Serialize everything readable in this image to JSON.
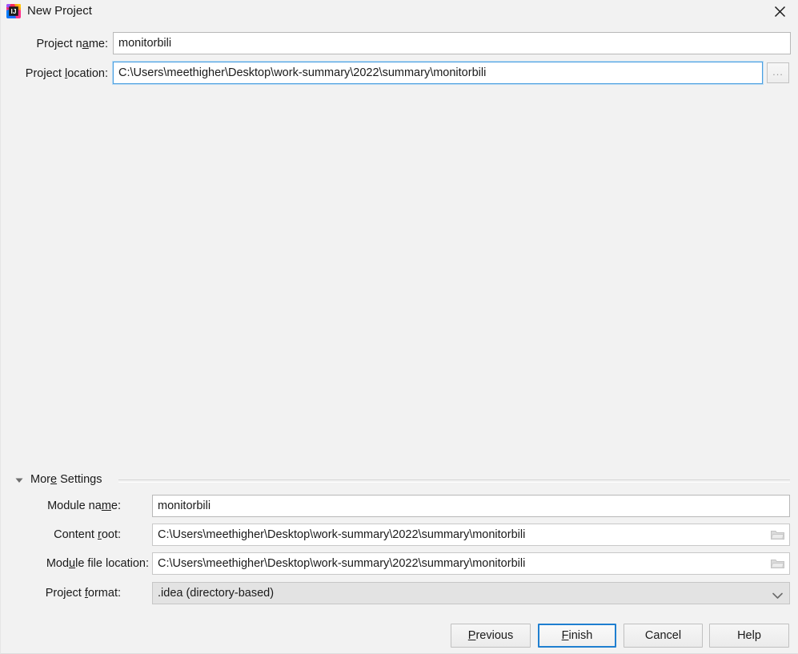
{
  "window": {
    "title": "New Project",
    "app_icon": "intellij-idea-icon",
    "close_icon": "close-icon",
    "background_color": "#f2f2f2"
  },
  "form": {
    "project_name": {
      "label_pre": "Project n",
      "label_mnemonic": "a",
      "label_post": "me:",
      "value": "monitorbili",
      "placeholder": ""
    },
    "project_location": {
      "label_pre": "Project ",
      "label_mnemonic": "l",
      "label_post": "ocation:",
      "value": "C:\\Users\\meethigher\\Desktop\\work-summary\\2022\\summary\\monitorbili",
      "placeholder": "",
      "browse_label": "..."
    }
  },
  "more_settings": {
    "label_pre": "Mor",
    "label_mnemonic": "e",
    "label_post": " Settings",
    "expanded": true,
    "triangle_icon": "chevron-down-icon",
    "fields": {
      "module_name": {
        "label_pre": "Module na",
        "label_mnemonic": "m",
        "label_post": "e:",
        "value": "monitorbili"
      },
      "content_root": {
        "label_pre": "Content ",
        "label_mnemonic": "r",
        "label_post": "oot:",
        "value": "C:\\Users\\meethigher\\Desktop\\work-summary\\2022\\summary\\monitorbili",
        "browse_icon": "folder-icon"
      },
      "module_file_location": {
        "label_pre": "Mod",
        "label_mnemonic": "u",
        "label_post": "le file location:",
        "value": "C:\\Users\\meethigher\\Desktop\\work-summary\\2022\\summary\\monitorbili",
        "browse_icon": "folder-icon"
      },
      "project_format": {
        "label_pre": "Project ",
        "label_mnemonic": "f",
        "label_post": "ormat:",
        "value": ".idea (directory-based)",
        "arrow_icon": "chevron-down-icon",
        "options": [
          ".idea (directory-based)"
        ]
      }
    }
  },
  "buttons": {
    "previous": {
      "pre": "",
      "mnemonic": "P",
      "post": "revious",
      "default": false
    },
    "finish": {
      "pre": "",
      "mnemonic": "F",
      "post": "inish",
      "default": true
    },
    "cancel": {
      "pre": "Cancel",
      "mnemonic": "",
      "post": "",
      "default": false
    },
    "help": {
      "pre": "Help",
      "mnemonic": "",
      "post": "",
      "default": false
    }
  },
  "colors": {
    "focus_blue": "#1f7fd0",
    "field_focus_border": "#4a9fe0",
    "dialog_bg": "#f2f2f2"
  }
}
